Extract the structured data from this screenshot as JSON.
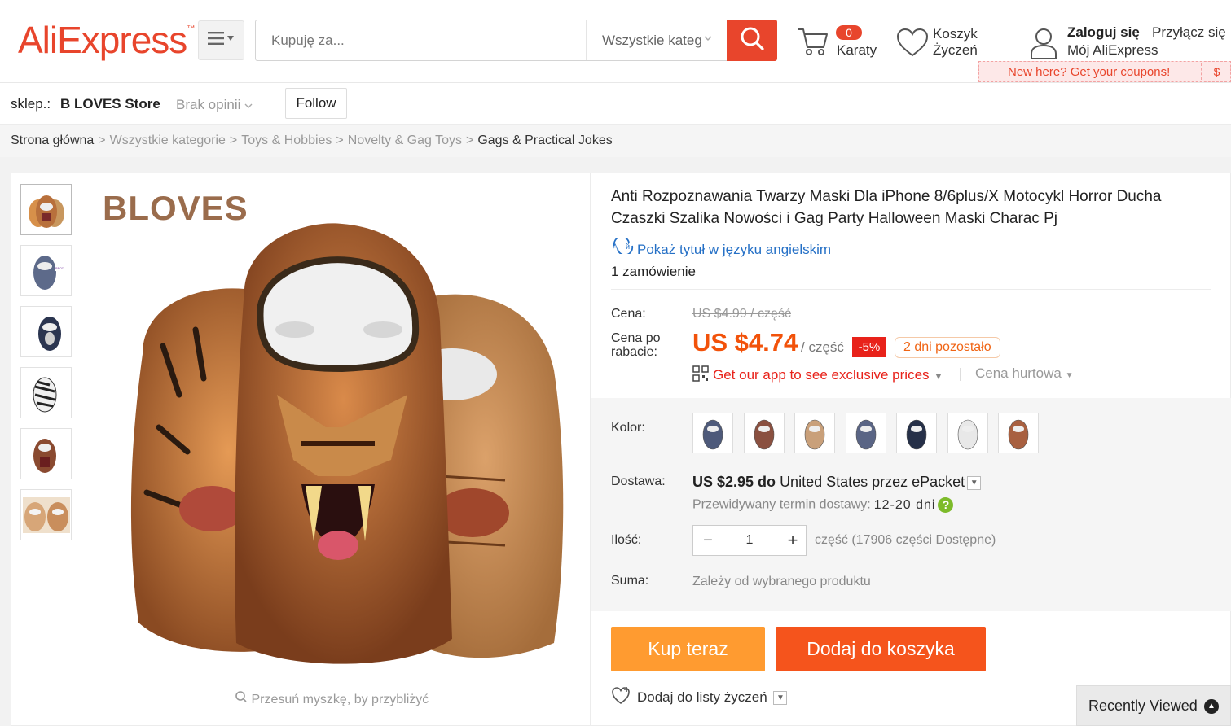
{
  "header": {
    "logo": "AliExpress",
    "logo_tm": "™",
    "search_placeholder": "Kupuję za...",
    "search_category": "Wszystkie kateg",
    "cart_count": "0",
    "cart_label": "Karaty",
    "wishlist_line1": "Koszyk",
    "wishlist_line2": "Życzeń",
    "signin": "Zaloguj się",
    "join": "Przyłącz się",
    "my_account": "Mój AliExpress",
    "coupon_text": "New here? Get your coupons!",
    "coupon_dollar": "$"
  },
  "store": {
    "prefix": "sklep.:",
    "name": "B LOVES Store",
    "rating": "Brak opinii",
    "follow": "Follow"
  },
  "breadcrumb": [
    "Strona główna",
    "Wszystkie kategorie",
    "Toys & Hobbies",
    "Novelty & Gag Toys",
    "Gags & Practical Jokes"
  ],
  "breadcrumb_sep": ">",
  "gallery": {
    "brand_overlay": "BLOVES",
    "zoom_hint": "Przesuń myszkę, by przybliżyć",
    "thumb_colors": [
      "#c08a52",
      "#5d6a8a",
      "#2b3550",
      "#ffffff",
      "#8a4a30",
      "#d7a678"
    ]
  },
  "product": {
    "title": "Anti Rozpoznawania Twarzy Maski Dla iPhone 8/6plus/X Motocykl Horror Ducha Czaszki Szalika Nowości i Gag Party Halloween Maski Charac Pj",
    "translate_link": "Pokaż tytuł w języku angielskim",
    "orders": "1 zamówienie",
    "price_label": "Cena:",
    "old_price": "US $4.99 / część",
    "discount_label_1": "Cena po",
    "discount_label_2": "rabacie:",
    "new_price": "US $4.74",
    "unit": "/ część",
    "discount_badge": "-5%",
    "days_left": "2 dni pozostało",
    "app_promo": "Get our app to see exclusive prices",
    "wholesale": "Cena hurtowa",
    "color_label": "Kolor:",
    "swatch_colors": [
      "#4e5a7a",
      "#8a5040",
      "#c9a07a",
      "#5a6585",
      "#263048",
      "#e8e8e8",
      "#a86040"
    ],
    "shipping_label": "Dostawa:",
    "shipping_price": "US $2.95 do",
    "shipping_rest": "United States przez ePacket",
    "delivery_label": "Przewidywany termin dostawy:",
    "delivery_value": "12-20 dni",
    "delivery_help": "?",
    "qty_label": "Ilość:",
    "qty_value": "1",
    "qty_available": "część (17906 części Dostępne)",
    "total_label": "Suma:",
    "total_value": "Zależy od wybranego produktu",
    "buy_now": "Kup teraz",
    "add_to_cart": "Dodaj do koszyka",
    "add_wishlist": "Dodaj do listy życzeń"
  },
  "recently_viewed": "Recently Viewed",
  "colors": {
    "accent": "#e8452c",
    "price": "#f2520a",
    "buy_now": "#ff9b30",
    "add_cart": "#f5541c",
    "link": "#2570c6"
  }
}
